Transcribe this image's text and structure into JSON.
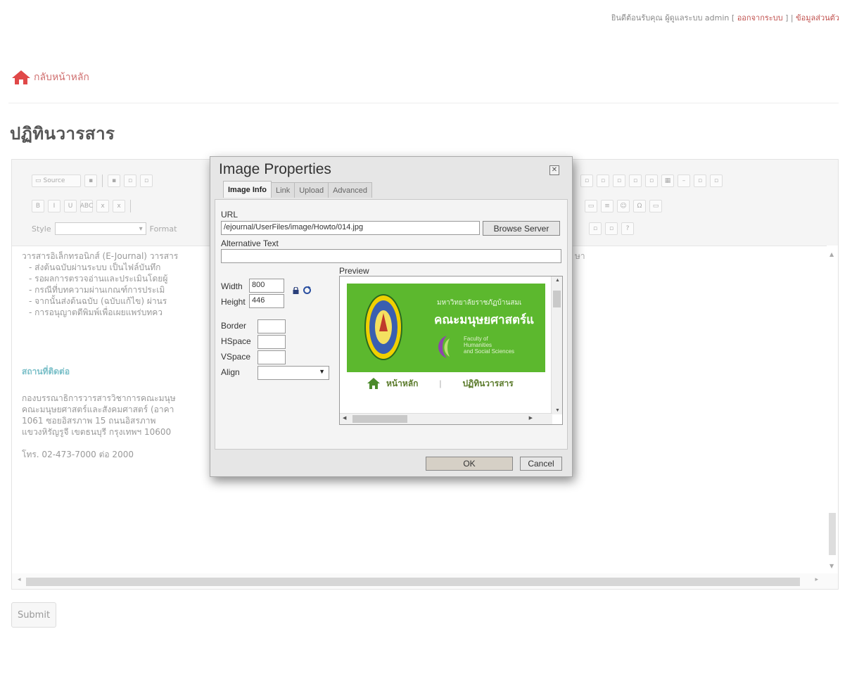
{
  "topbar": {
    "welcome": "ยินดีต้อนรับคุณ ผู้ดูแลระบบ admin",
    "logout": "ออกจากระบบ",
    "profile": "ข้อมูลส่วนตัว"
  },
  "nav": {
    "home_label": "กลับหน้าหลัก"
  },
  "page": {
    "title": "ปฏิทินวารสาร"
  },
  "toolbar": {
    "source_label": "Source",
    "bold": "B",
    "italic": "I",
    "underline": "U",
    "strike": "ABC",
    "style_label": "Style",
    "format_label": "Format"
  },
  "content": {
    "intro": "วารสารอิเล็กทรอนิกส์ (E-Journal) วารสาร",
    "bullets": [
      "- ส่งต้นฉบับผ่านระบบ เป็นไฟล์บันทึก",
      "- รอผลการตรวจอ่านและประเมินโดยผู้",
      "- กรณีที่บทความผ่านเกณฑ์การประเมิ",
      "- จากนั้นส่งต้นฉบับ (ฉบับแก้ไข) ผ่านร",
      "- การอนุญาตตีพิมพ์เพื่อเผยแพร่บทคว"
    ],
    "right_fragment": "ษา",
    "contact_heading": "สถานที่ติดต่อ",
    "address_lines": [
      "กองบรรณาธิการวารสารวิชาการคณะมนุษ",
      "คณะมนุษยศาสตร์และสังคมศาสตร์ (อาคา",
      "1061 ซอยอิสรภาพ 15 ถนนอิสรภาพ",
      "แขวงหิรัญรูจี เขตธนบุรี กรุงเทพฯ 10600"
    ],
    "phone": "โทร. 02-473-7000 ต่อ 2000"
  },
  "submit_label": "Submit",
  "dialog": {
    "title": "Image Properties",
    "close_glyph": "✕",
    "tabs": [
      "Image Info",
      "Link",
      "Upload",
      "Advanced"
    ],
    "url_label": "URL",
    "url_value": "/ejournal/UserFiles/image/Howto/014.jpg",
    "browse_label": "Browse Server",
    "alt_label": "Alternative Text",
    "alt_value": "",
    "width_label": "Width",
    "width_value": "800",
    "height_label": "Height",
    "height_value": "446",
    "border_label": "Border",
    "hspace_label": "HSpace",
    "vspace_label": "VSpace",
    "align_label": "Align",
    "preview_label": "Preview",
    "preview": {
      "university": "มหาวิทยาลัยราชภัฏบ้านสมเ",
      "faculty": "คณะมนุษยศาสตร์แ",
      "english": [
        "Faculty of",
        "Humanities",
        "and Social Sciences"
      ],
      "nav_home": "หน้าหลัก",
      "nav_sep": "|",
      "nav_calendar": "ปฏิทินวารสาร"
    },
    "ok_label": "OK",
    "cancel_label": "Cancel"
  }
}
